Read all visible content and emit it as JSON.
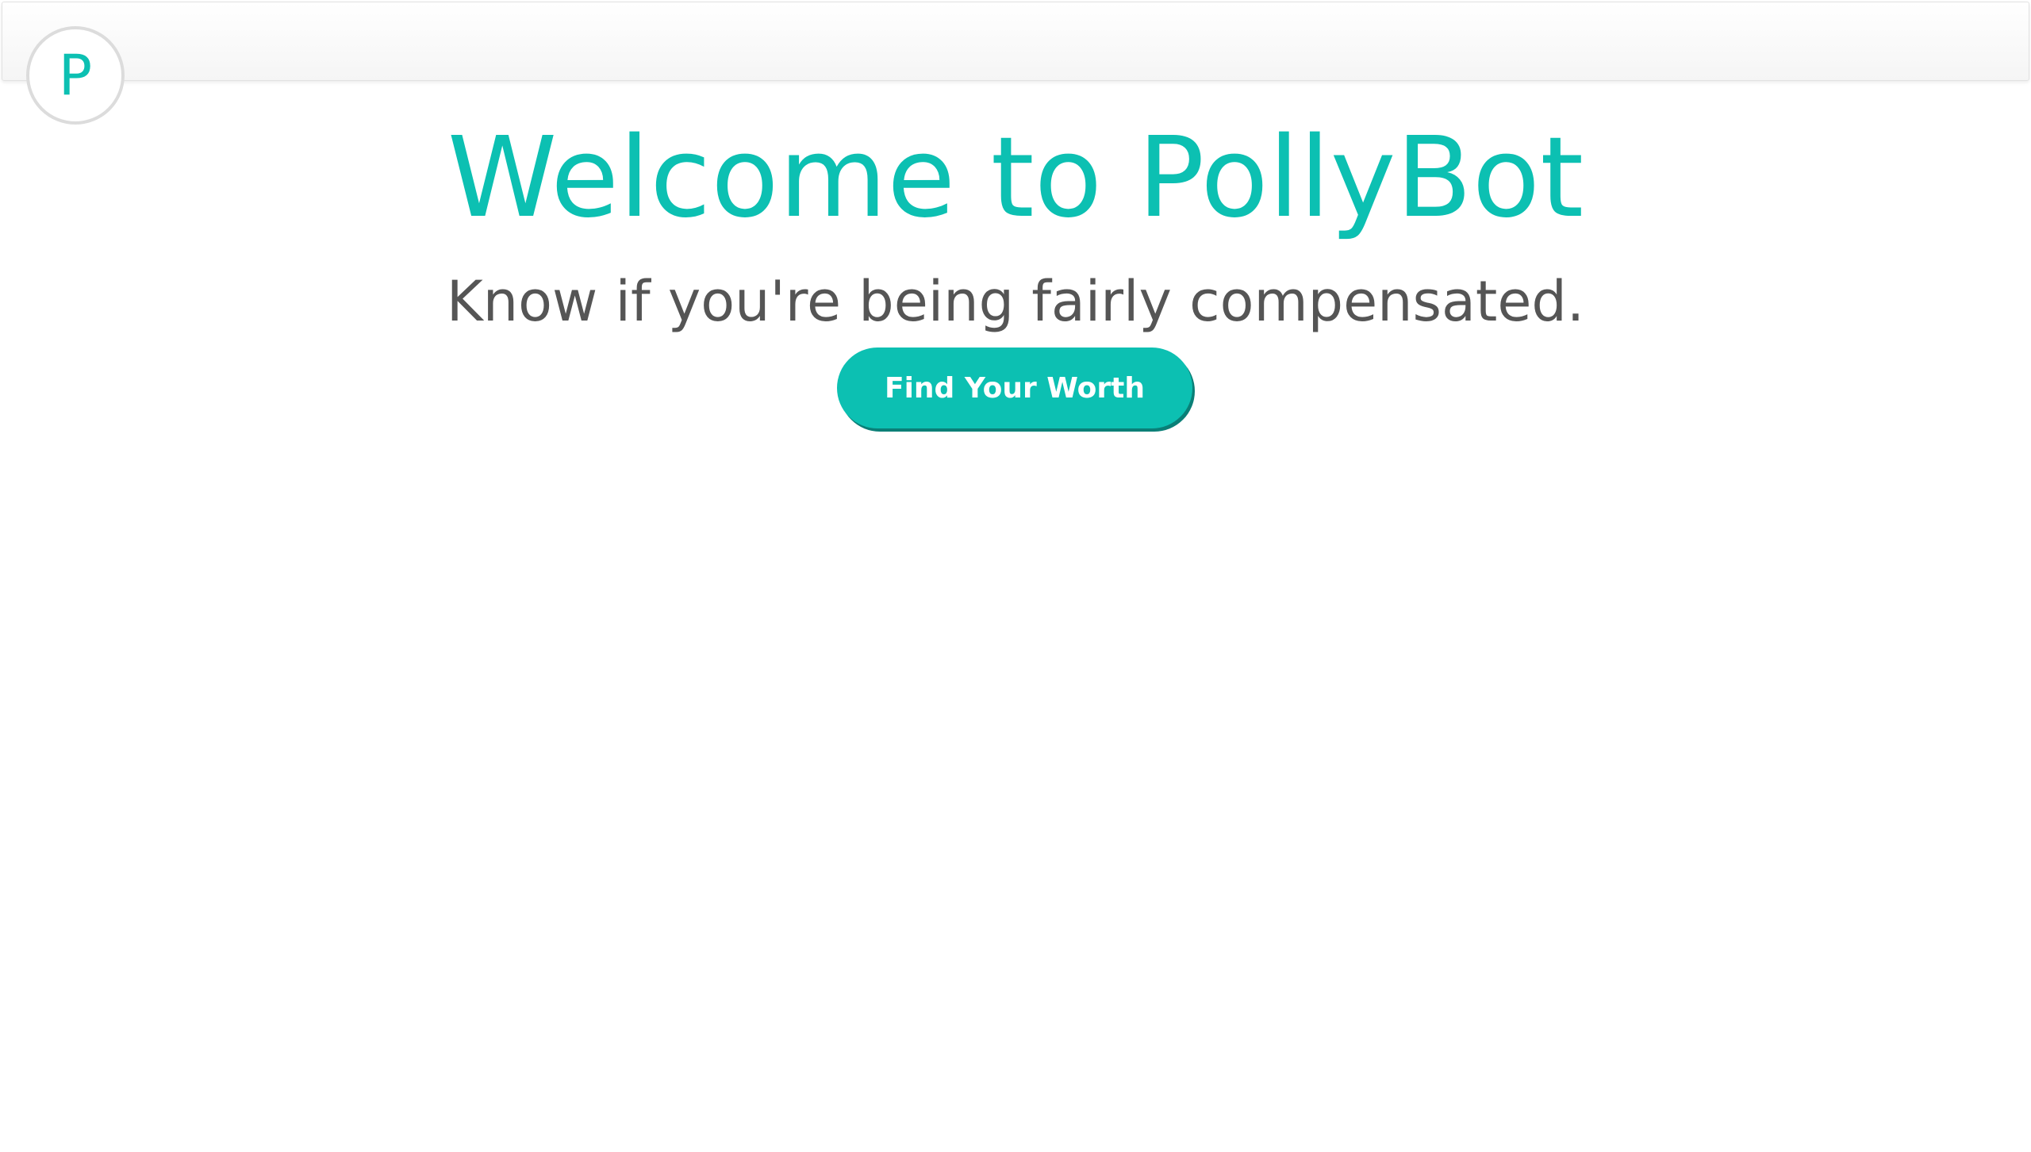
{
  "header": {
    "logo_letter": "P"
  },
  "hero": {
    "title": "Welcome to PollyBot",
    "subtitle": "Know if you're being fairly compensated.",
    "cta_label": "Find Your Worth"
  },
  "colors": {
    "accent": "#0cc0b2",
    "button_shadow": "#0a7f77",
    "subtitle_text": "#555555",
    "logo_border": "#dcdcdc",
    "background": "#ffffff"
  },
  "icons": {
    "logo": "letter-p-circle-logo"
  }
}
